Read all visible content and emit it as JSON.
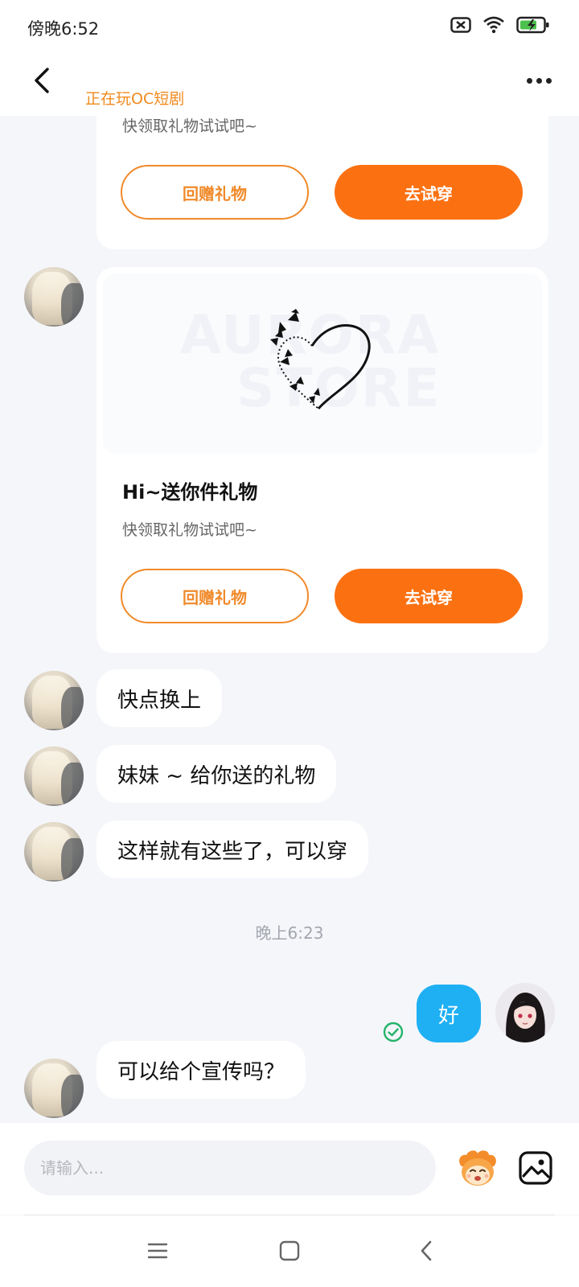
{
  "status_bar": {
    "time": "傍晚6:52",
    "icons": [
      "sim-off-icon",
      "wifi-icon",
      "battery-charging-icon"
    ]
  },
  "header": {
    "back_icon": "chevron-left-icon",
    "subtitle": "正在玩OC短剧",
    "more_icon": "more-dots-icon"
  },
  "messages": {
    "gift_card_1": {
      "desc": "快领取礼物试试吧~",
      "return_gift_label": "回赠礼物",
      "try_on_label": "去试穿"
    },
    "gift_card_2": {
      "watermark": [
        "AURORA",
        "STORE"
      ],
      "title": "Hi~送你件礼物",
      "desc": "快领取礼物试试吧~",
      "return_gift_label": "回赠礼物",
      "try_on_label": "去试穿"
    },
    "text_1": "快点换上",
    "text_2": "妹妹 ~ 给你送的礼物",
    "text_3": "这样就有这些了，可以穿",
    "timestamp": "晚上6:23",
    "self_text": "好",
    "text_4": "可以给个宣传吗？"
  },
  "input": {
    "placeholder": "请输入...",
    "emoji_icon": "emoji-mascot-icon",
    "image_icon": "image-icon"
  },
  "nav": {
    "icons": [
      "menu-icon",
      "home-square-icon",
      "back-triangle-icon"
    ]
  },
  "colors": {
    "accent_orange": "#fb7112",
    "outline_orange": "#f08a2a",
    "self_bubble": "#1fb0f3",
    "read_check": "#25b36a",
    "background": "#f4f6fa"
  }
}
